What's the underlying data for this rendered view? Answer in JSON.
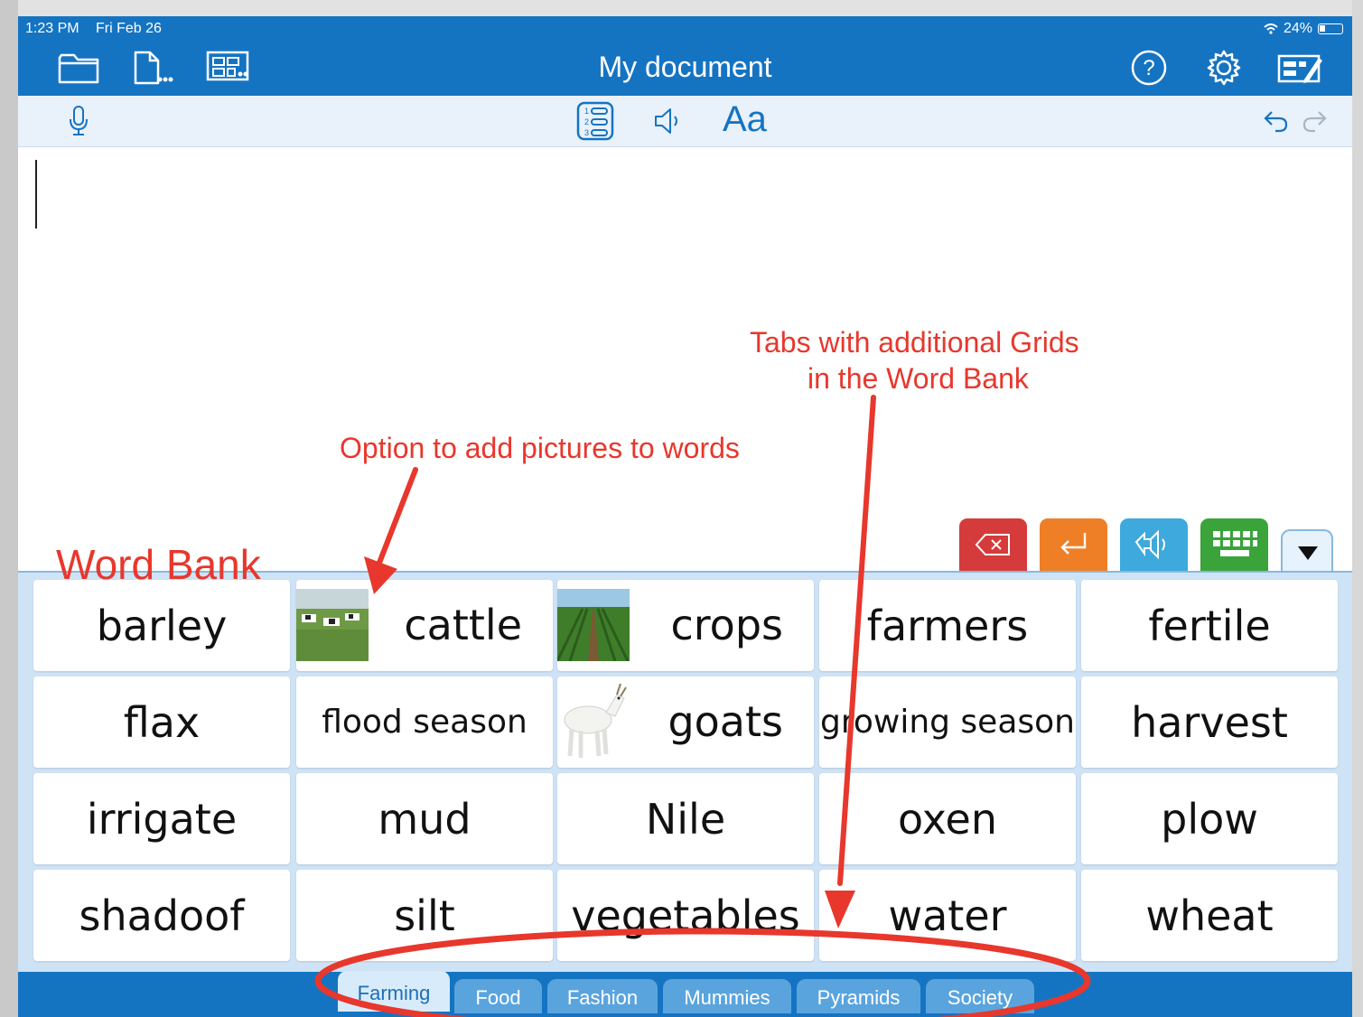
{
  "status_bar": {
    "time": "1:23 PM",
    "date": "Fri Feb 26",
    "battery": "24%"
  },
  "nav": {
    "title": "My document",
    "left_icons": [
      "folder-icon",
      "document-more-icon",
      "grid-more-icon"
    ],
    "right_icons": [
      "help-icon",
      "settings-icon",
      "edit-grid-icon"
    ]
  },
  "toolbar": {
    "icons": [
      "microphone-icon",
      "numbered-list-icon",
      "speaker-icon",
      "font-style-icon",
      "undo-icon",
      "redo-icon"
    ],
    "font_label": "Aa",
    "list_numbers": [
      "1",
      "2",
      "3"
    ]
  },
  "annotations": {
    "word_bank": "Word Bank",
    "pictures": "Option to add pictures to words",
    "tabs_line1": "Tabs with additional Grids",
    "tabs_line2": "in the Word Bank"
  },
  "controls": [
    "delete-key",
    "return-key",
    "speak-all",
    "keyboard",
    "collapse"
  ],
  "word_bank": {
    "rows": [
      [
        {
          "word": "barley"
        },
        {
          "word": "cattle",
          "picture": "cattle-photo"
        },
        {
          "word": "crops",
          "picture": "crops-photo"
        },
        {
          "word": "farmers"
        },
        {
          "word": "fertile"
        }
      ],
      [
        {
          "word": "flax"
        },
        {
          "word": "flood season"
        },
        {
          "word": "goats",
          "picture": "goat-photo"
        },
        {
          "word": "growing season"
        },
        {
          "word": "harvest"
        }
      ],
      [
        {
          "word": "irrigate"
        },
        {
          "word": "mud"
        },
        {
          "word": "Nile"
        },
        {
          "word": "oxen"
        },
        {
          "word": "plow"
        }
      ],
      [
        {
          "word": "shadoof"
        },
        {
          "word": "silt"
        },
        {
          "word": "vegetables"
        },
        {
          "word": "water"
        },
        {
          "word": "wheat"
        }
      ]
    ]
  },
  "tabs": [
    {
      "label": "Farming",
      "active": true
    },
    {
      "label": "Food",
      "active": false
    },
    {
      "label": "Fashion",
      "active": false
    },
    {
      "label": "Mummies",
      "active": false
    },
    {
      "label": "Pyramids",
      "active": false
    },
    {
      "label": "Society",
      "active": false
    }
  ],
  "colors": {
    "nav_blue": "#1574c2",
    "annotation_red": "#e8372c",
    "delete_red": "#d63b3b",
    "return_orange": "#ef7f26",
    "speak_blue": "#3da9dc",
    "keyboard_green": "#3aa33a",
    "wordbank_bg": "#cfe3f6"
  }
}
